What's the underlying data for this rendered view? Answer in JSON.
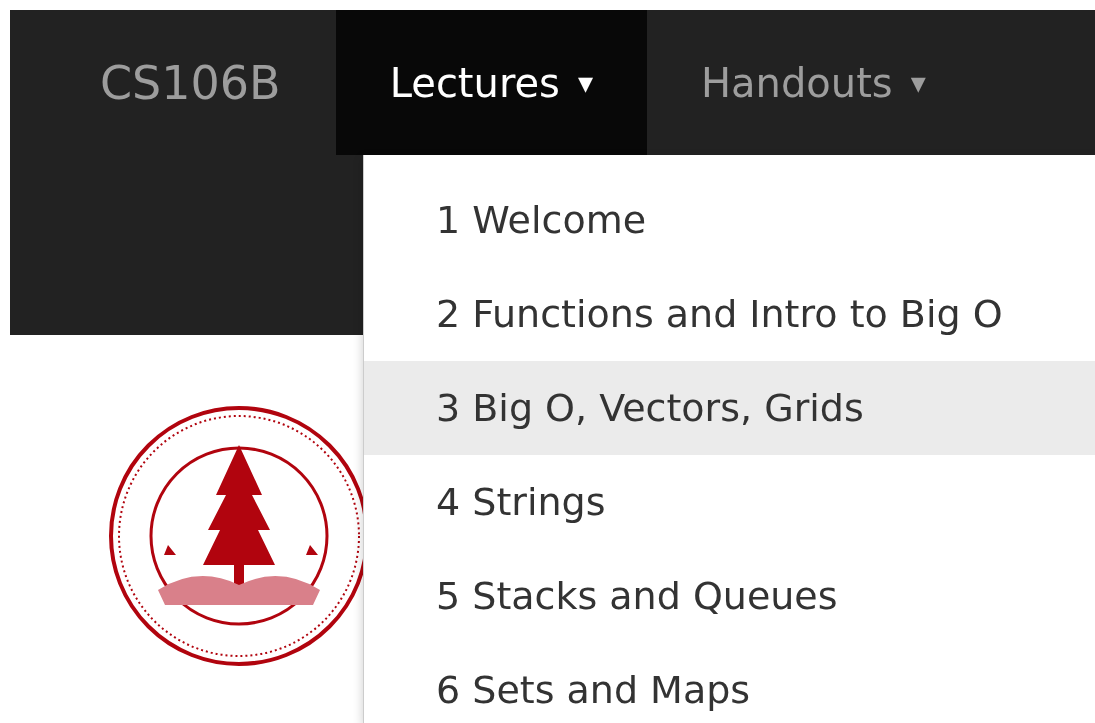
{
  "navbar": {
    "brand": "CS106B",
    "items": [
      {
        "label": "Lectures",
        "selected": true,
        "caret": "▾"
      },
      {
        "label": "Handouts",
        "selected": false,
        "caret": "▾"
      }
    ]
  },
  "dropdown": {
    "items": [
      {
        "label": "1 Welcome",
        "highlighted": false
      },
      {
        "label": "2 Functions and Intro to Big O",
        "highlighted": false
      },
      {
        "label": "3 Big O, Vectors, Grids",
        "highlighted": true
      },
      {
        "label": "4 Strings",
        "highlighted": false
      },
      {
        "label": "5 Stacks and Queues",
        "highlighted": false
      },
      {
        "label": "6 Sets and Maps",
        "highlighted": false
      }
    ]
  }
}
